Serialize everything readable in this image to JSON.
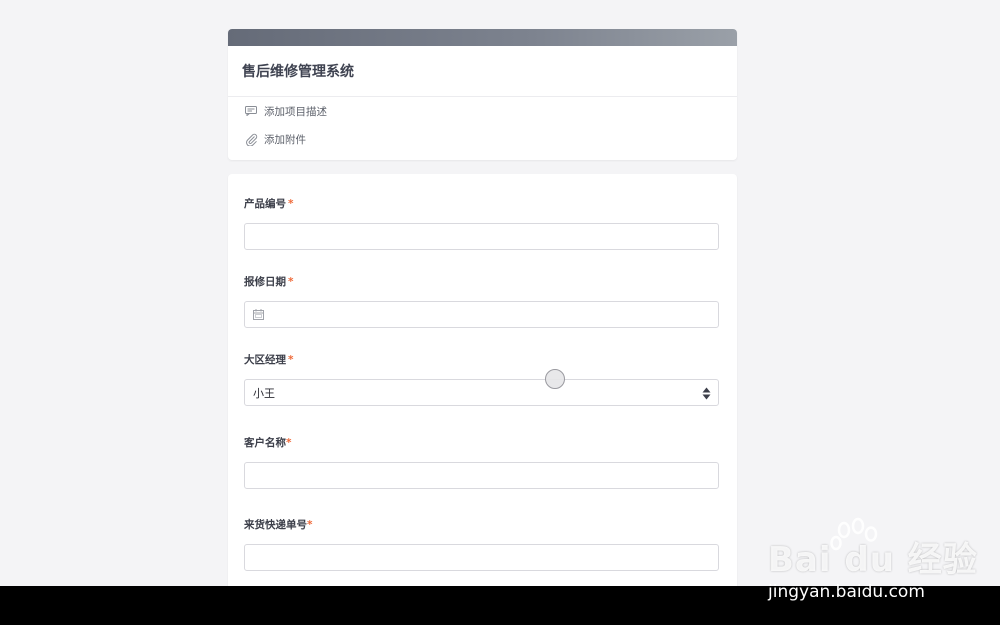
{
  "form": {
    "title": "售后维修管理系统",
    "actions": {
      "add_description": "添加项目描述",
      "add_attachment": "添加附件"
    }
  },
  "fields": {
    "product_no": {
      "label": "产品编号",
      "required": "*",
      "value": ""
    },
    "repair_date": {
      "label": "报修日期",
      "required": "*",
      "value": ""
    },
    "regional_manager": {
      "label": "大区经理",
      "required": "*",
      "value": "小王"
    },
    "customer_name": {
      "label": "客户名称",
      "required": "*",
      "value": ""
    },
    "tracking_no": {
      "label": "来货快递单号",
      "required": "*",
      "value": ""
    }
  },
  "watermark": {
    "logo_text": "Bai du 经验",
    "url": "jingyan.baidu.com"
  },
  "colors": {
    "header_bar": "#656b78",
    "required_mark": "#ef6b3b",
    "page_bg": "#f4f4f6"
  }
}
